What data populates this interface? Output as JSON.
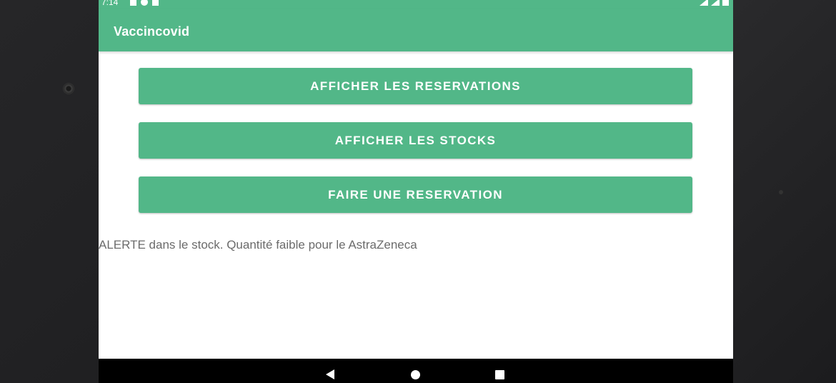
{
  "statusbar": {
    "time": "7:14"
  },
  "appbar": {
    "title": "Vaccincovid",
    "color": "#52b788"
  },
  "buttons": {
    "show_reservations": "AFFICHER LES RESERVATIONS",
    "show_stocks": "AFFICHER LES STOCKS",
    "make_reservation": "FAIRE UNE RESERVATION"
  },
  "alert": {
    "text": "ALERTE dans le stock. Quantité faible pour le AstraZeneca"
  },
  "navbar": {
    "icons": [
      "back-icon",
      "home-icon",
      "recents-icon"
    ]
  }
}
